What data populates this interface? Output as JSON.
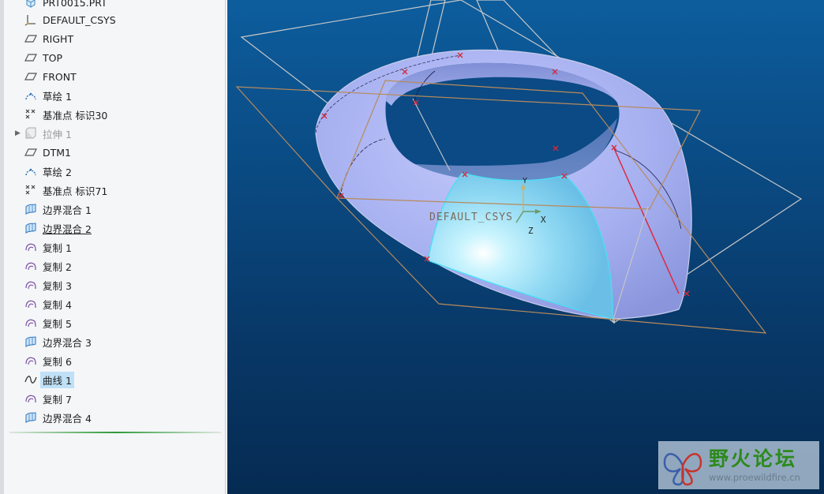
{
  "model_tree": {
    "root_label": "PRT0015.PRT",
    "items": [
      {
        "label": "DEFAULT_CSYS",
        "icon": "csys-icon"
      },
      {
        "label": "RIGHT",
        "icon": "datum-plane-icon"
      },
      {
        "label": "TOP",
        "icon": "datum-plane-icon"
      },
      {
        "label": "FRONT",
        "icon": "datum-plane-icon"
      },
      {
        "label": "草绘 1",
        "icon": "sketch-icon"
      },
      {
        "label": "基准点 标识30",
        "icon": "datum-point-icon"
      },
      {
        "label": "拉伸 1",
        "icon": "extrude-icon",
        "state": "suppressed",
        "expandable": true
      },
      {
        "label": "DTM1",
        "icon": "datum-plane-icon"
      },
      {
        "label": "草绘 2",
        "icon": "sketch-icon"
      },
      {
        "label": "基准点 标识71",
        "icon": "datum-point-icon"
      },
      {
        "label": "边界混合 1",
        "icon": "boundary-blend-icon"
      },
      {
        "label": "边界混合 2",
        "icon": "boundary-blend-icon",
        "state": "underlined"
      },
      {
        "label": "复制 1",
        "icon": "copy-icon"
      },
      {
        "label": "复制 2",
        "icon": "copy-icon"
      },
      {
        "label": "复制 3",
        "icon": "copy-icon"
      },
      {
        "label": "复制 4",
        "icon": "copy-icon"
      },
      {
        "label": "复制 5",
        "icon": "copy-icon"
      },
      {
        "label": "边界混合 3",
        "icon": "boundary-blend-icon"
      },
      {
        "label": "复制 6",
        "icon": "copy-icon"
      },
      {
        "label": "曲线 1",
        "icon": "curve-icon",
        "state": "selected"
      },
      {
        "label": "复制 7",
        "icon": "copy-icon"
      },
      {
        "label": "边界混合 4",
        "icon": "boundary-blend-icon"
      }
    ]
  },
  "viewport": {
    "csys_label": "DEFAULT_CSYS",
    "axis_x": "X",
    "axis_y": "Y",
    "axis_z": "Z",
    "colors": {
      "surface": "#a9b3f2",
      "highlight_surface": "#8ee6fb",
      "datum_plane_grey": "#c8c8c8",
      "datum_plane_brown": "#b78a5c",
      "point_marker": "#d42a3a",
      "selected_curve": "#e0283c"
    }
  },
  "watermark": {
    "title": "野火论坛",
    "url": "www.proewildfire.cn"
  }
}
